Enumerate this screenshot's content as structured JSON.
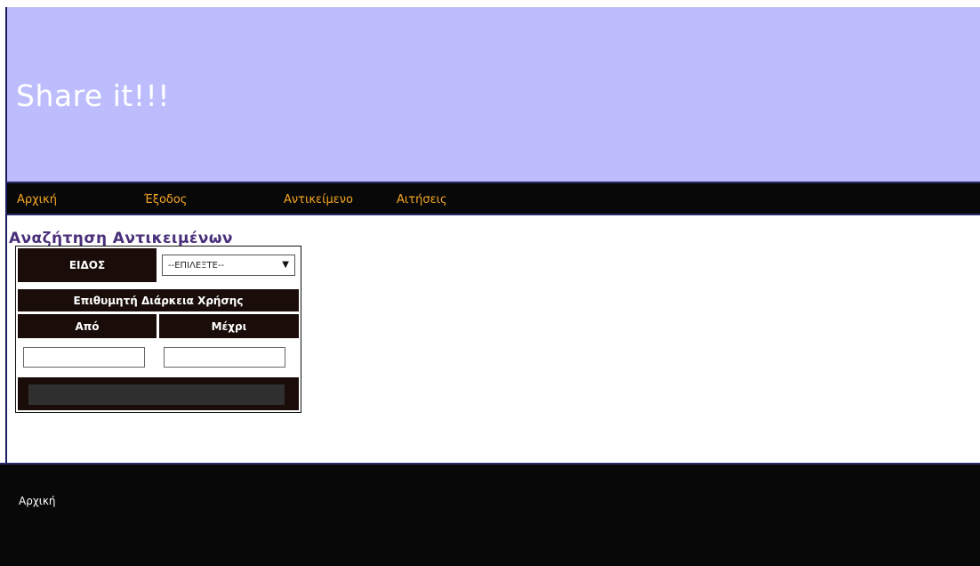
{
  "header": {
    "title": "Share it!!!"
  },
  "nav": {
    "items": [
      "Αρχική",
      "Έξοδος",
      "Αντικείμενο",
      "Αιτήσεις"
    ]
  },
  "search": {
    "title": "Αναζήτηση Αντικειμένων",
    "type_label": "ΕΙΔΟΣ",
    "type_select_value": "--ΕΠΙΛΕΞΤΕ--",
    "duration_label": "Επιθυμητή Διάρκεια Χρήσης",
    "from_label": "Από",
    "to_label": "Μέχρι",
    "from_value": "",
    "to_value": "",
    "submit_label": ""
  },
  "footer": {
    "link": "Αρχική"
  },
  "colors": {
    "header_bg": "#bdbdfd",
    "nav_bg": "#080808",
    "nav_link": "#f5a623",
    "form_dark": "#1a0d09",
    "section_title": "#4a2f7a"
  }
}
